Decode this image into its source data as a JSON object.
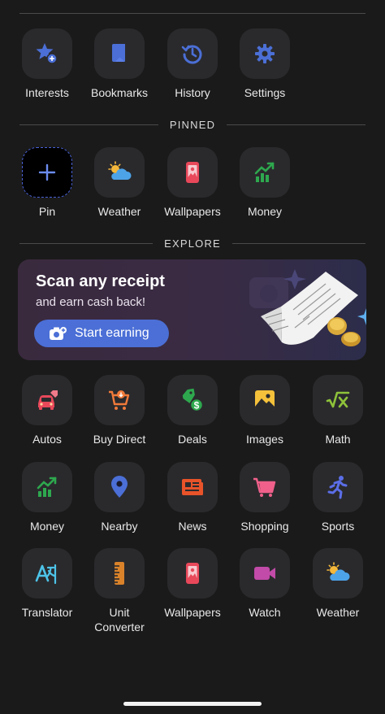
{
  "top": {
    "items": [
      {
        "label": "Interests",
        "icon": "star-plus-icon"
      },
      {
        "label": "Bookmarks",
        "icon": "bookmark-icon"
      },
      {
        "label": "History",
        "icon": "history-icon"
      },
      {
        "label": "Settings",
        "icon": "gear-icon"
      }
    ]
  },
  "pinned": {
    "header": "PINNED",
    "items": [
      {
        "label": "Pin",
        "icon": "plus-icon"
      },
      {
        "label": "Weather",
        "icon": "weather-icon"
      },
      {
        "label": "Wallpapers",
        "icon": "wallpaper-icon"
      },
      {
        "label": "Money",
        "icon": "money-chart-icon"
      }
    ]
  },
  "explore": {
    "header": "EXPLORE",
    "banner": {
      "title": "Scan any receipt",
      "subtitle": "and earn cash back!",
      "cta": "Start earning"
    },
    "grid": [
      {
        "label": "Autos",
        "icon": "car-icon"
      },
      {
        "label": "Buy Direct",
        "icon": "cart-icon"
      },
      {
        "label": "Deals",
        "icon": "tag-icon"
      },
      {
        "label": "Images",
        "icon": "image-icon"
      },
      {
        "label": "Math",
        "icon": "math-icon"
      },
      {
        "label": "Money",
        "icon": "money-chart-icon"
      },
      {
        "label": "Nearby",
        "icon": "location-pin-icon"
      },
      {
        "label": "News",
        "icon": "newspaper-icon"
      },
      {
        "label": "Shopping",
        "icon": "shopping-cart-icon"
      },
      {
        "label": "Sports",
        "icon": "runner-icon"
      },
      {
        "label": "Translator",
        "icon": "translate-icon"
      },
      {
        "label": "Unit Converter",
        "icon": "ruler-icon"
      },
      {
        "label": "Wallpapers",
        "icon": "wallpaper-icon"
      },
      {
        "label": "Watch",
        "icon": "video-camera-icon"
      },
      {
        "label": "Weather",
        "icon": "weather-icon"
      }
    ]
  },
  "colors": {
    "background": "#1a1a1a",
    "tile": "#2a2a2d",
    "accent": "#4b6fd6"
  }
}
